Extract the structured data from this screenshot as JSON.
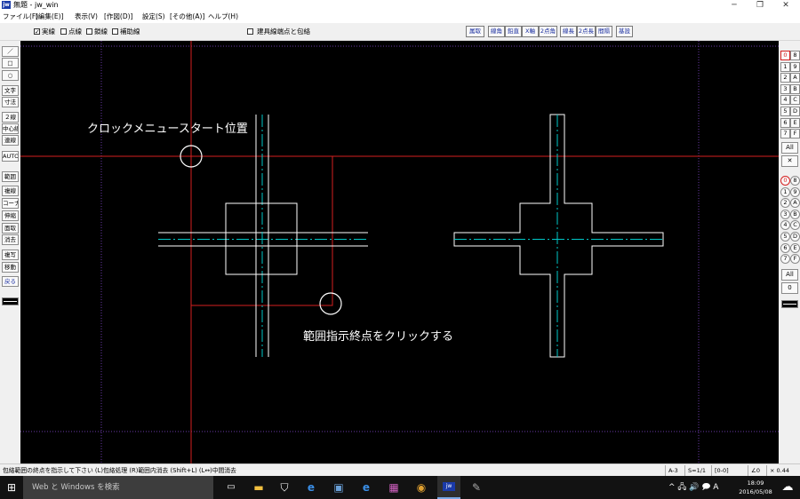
{
  "window": {
    "title": "無題 - jw_win",
    "icon_text": "jw"
  },
  "menu": [
    "ファイル(F)",
    "[編集(E)]",
    "表示(V)",
    "[作図(D)]",
    "設定(S)",
    "[その他(A)]",
    "ヘルプ(H)"
  ],
  "options": {
    "solid_line": "実線",
    "dotted_line": "点線",
    "chain_line": "鎖線",
    "aux_line": "補助線",
    "building_wrap": "建具線端点と包絡",
    "solid_checked": "✓"
  },
  "toolbar": [
    "属取",
    "線角",
    "鉛直",
    "X軸",
    "2点角",
    "線長",
    "2点長",
    "間隔",
    "基設"
  ],
  "left_tools": [
    "／",
    "□",
    "○",
    "文字",
    "寸法",
    "２線",
    "中心線",
    "連線",
    "AUTO",
    "範囲",
    "複線",
    "コーナー",
    "伸縮",
    "面取",
    "消去",
    "複写",
    "移動",
    "戻る"
  ],
  "right_layers": {
    "grid1": [
      [
        "0",
        "8"
      ],
      [
        "1",
        "9"
      ],
      [
        "2",
        "A"
      ],
      [
        "3",
        "B"
      ],
      [
        "4",
        "C"
      ],
      [
        "5",
        "D"
      ],
      [
        "6",
        "E"
      ],
      [
        "7",
        "F"
      ]
    ],
    "all1": "All",
    "x_btn": "✕",
    "grid2": [
      [
        "0",
        "8"
      ],
      [
        "1",
        "9"
      ],
      [
        "2",
        "A"
      ],
      [
        "3",
        "B"
      ],
      [
        "4",
        "C"
      ],
      [
        "5",
        "D"
      ],
      [
        "6",
        "E"
      ],
      [
        "7",
        "F"
      ]
    ],
    "all2": "All",
    "zero": "0"
  },
  "annotations": {
    "start": "クロックメニュースタート位置",
    "end": "範囲指示終点をクリックする"
  },
  "status": {
    "message": "包絡範囲の終点を指示して下さい (L)包絡処理 (R)範囲内消去 (Shift+L) (L↔)中間消去",
    "paper": "A-3",
    "scale": "S=1/1",
    "layer": "[0-0]",
    "angle": "∠0",
    "zoom": "× 0.44"
  },
  "taskbar": {
    "search_placeholder": "Web と Windows を検索",
    "tray": "^ 🖧 🔊 🗩 A",
    "time": "18:09",
    "date": "2016/05/08"
  },
  "colors": {
    "canvas": "#000000",
    "red_line": "#d42020",
    "cyan_line": "#00c8c8",
    "purple_guide": "#6a3aa8",
    "white": "#ffffff"
  }
}
